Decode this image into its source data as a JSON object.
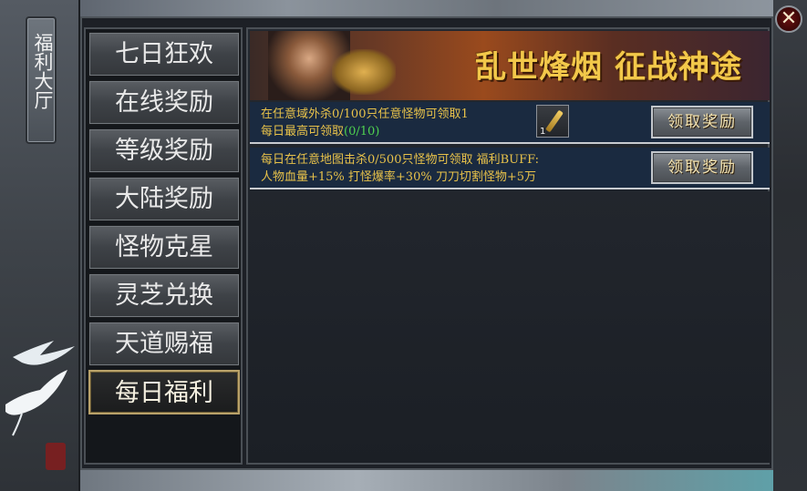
{
  "side": {
    "title": "福利大厅"
  },
  "close": {
    "glyph": "✕"
  },
  "menu": {
    "items": [
      {
        "label": "七日狂欢"
      },
      {
        "label": "在线奖励"
      },
      {
        "label": "等级奖励"
      },
      {
        "label": "大陆奖励"
      },
      {
        "label": "怪物克星"
      },
      {
        "label": "灵芝兑换"
      },
      {
        "label": "天道赐福"
      },
      {
        "label": "每日福利"
      }
    ],
    "active_index": 7
  },
  "banner": {
    "title": "乱世烽烟 征战神途"
  },
  "tasks": [
    {
      "line1": "在任意域外杀0/100只任意怪物可领取1",
      "line2_prefix": "每日最高可领取",
      "line2_progress": "(0/10)",
      "item_count": "1",
      "button": "领取奖励"
    },
    {
      "line1": "每日在任意地图击杀0/500只怪物可领取 福利BUFF:",
      "line2": "人物血量+15% 打怪爆率+30% 刀刀切割怪物+5万",
      "button": "领取奖励"
    }
  ],
  "colors": {
    "task_text": "#e8c24a",
    "progress": "#4fd24f",
    "banner_title": "#f2c84a",
    "active_border": "#b9a26a"
  }
}
